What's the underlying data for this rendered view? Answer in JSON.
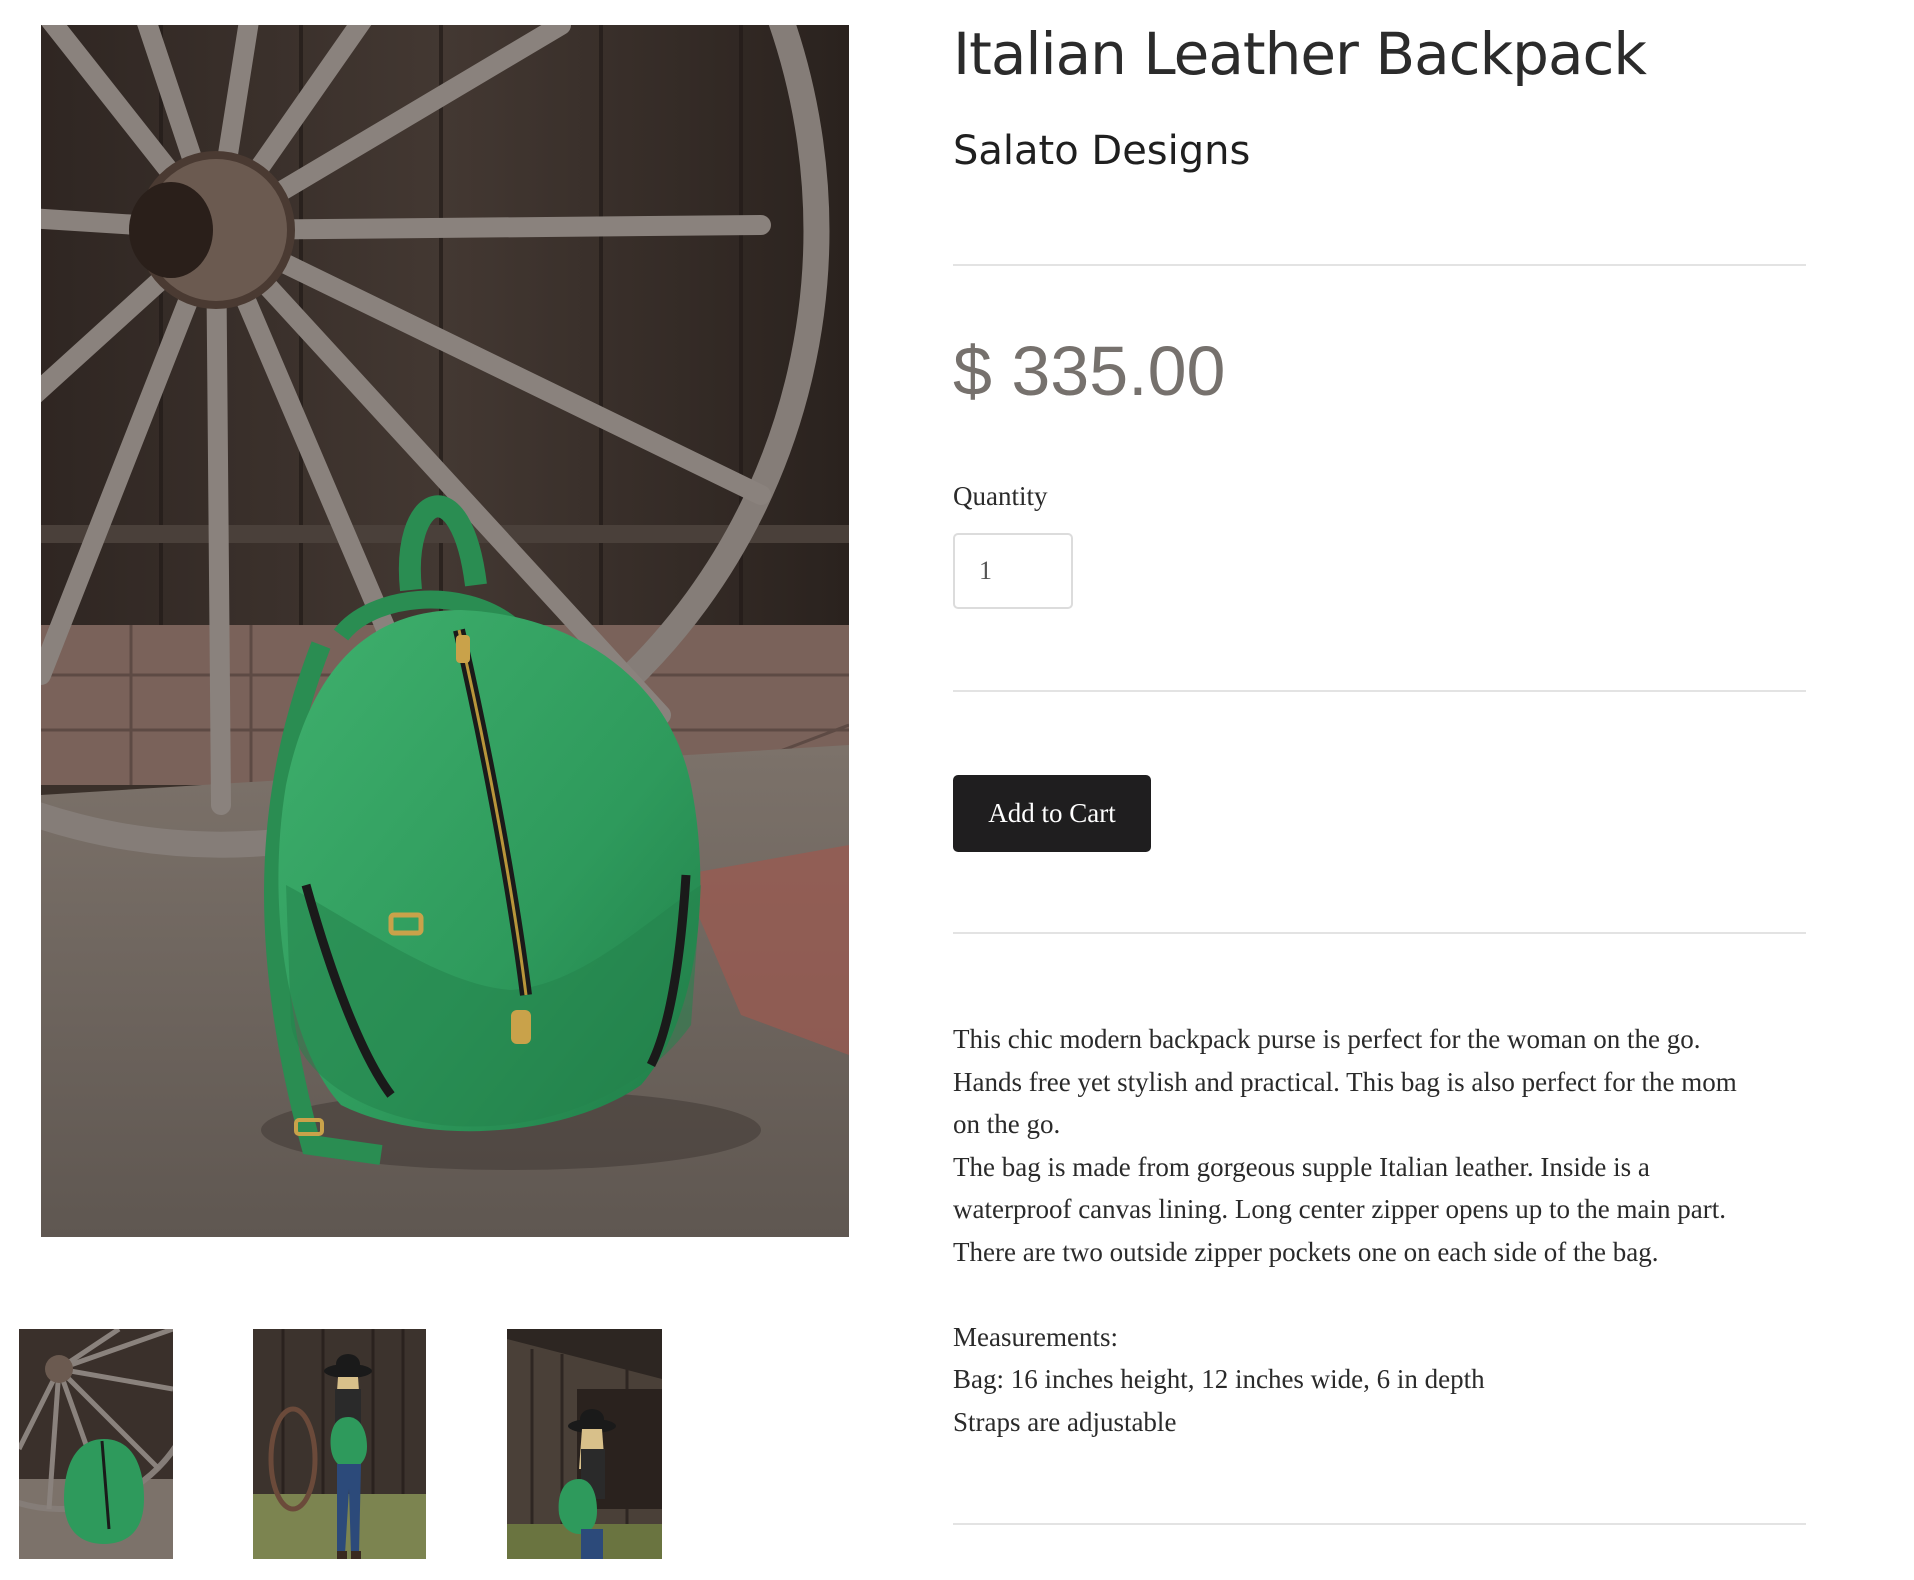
{
  "product": {
    "title": "Italian Leather Backpack",
    "vendor": "Salato Designs",
    "price": "$ 335.00",
    "quantity_label": "Quantity",
    "quantity_value": "1",
    "add_to_cart_label": "Add to Cart",
    "description": {
      "lines": [
        "This chic modern backpack purse is perfect for the woman on the go.",
        "Hands free yet stylish and practical. This bag is also perfect for the mom",
        "on the go.",
        "The bag is made from gorgeous supple Italian leather. Inside is a",
        "waterproof canvas lining. Long center zipper opens up to the main part.",
        "There are two outside zipper pockets one on each side of the bag."
      ],
      "measurements_lines": [
        "Measurements:",
        "Bag: 16 inches height, 12 inches wide, 6 in depth",
        "Straps are adjustable"
      ]
    }
  },
  "gallery": {
    "thumbnails": [
      "backpack-by-wagon-wheel",
      "woman-back-view",
      "woman-side-view"
    ]
  },
  "colors": {
    "backpack_green": "#2e9a5c",
    "price_gray": "#76716d",
    "button_dark": "#1f1e1f"
  }
}
